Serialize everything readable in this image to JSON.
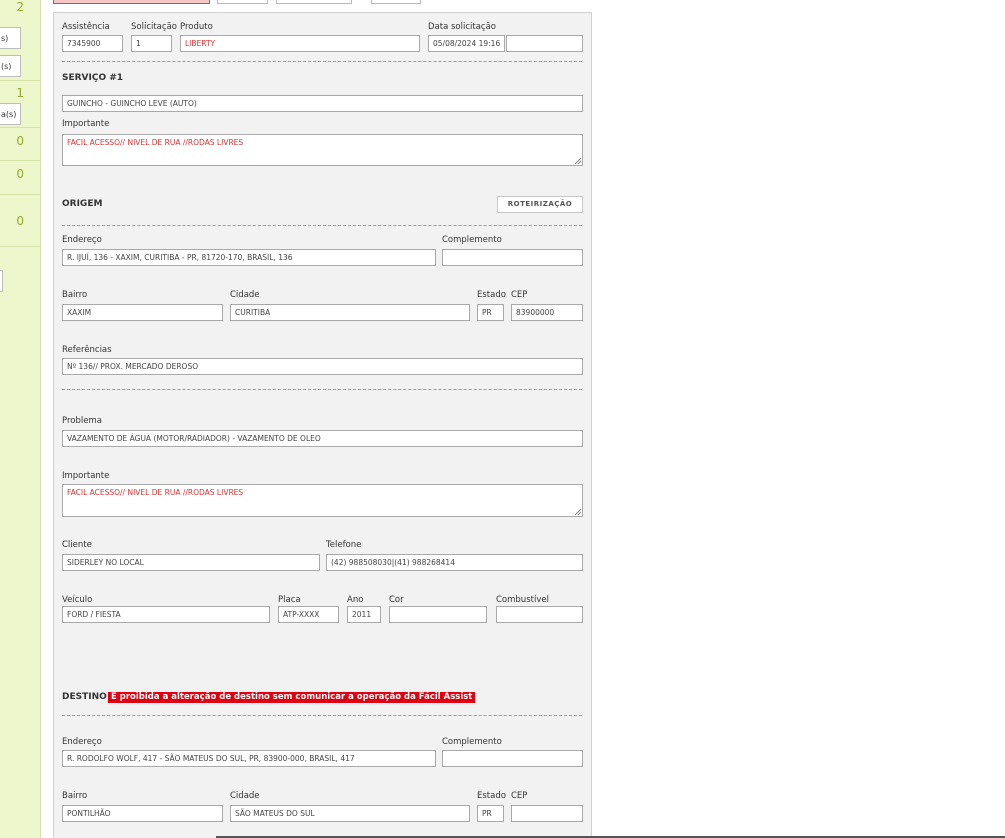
{
  "sidebar": {
    "counts": [
      "2",
      "1",
      "0",
      "0",
      "0"
    ],
    "cut_labels": [
      "s)",
      "(s)",
      "a(s)"
    ]
  },
  "header": {
    "assistencia_label": "Assistência",
    "assistencia_value": "7345900",
    "solicitacao_label": "Solicitação",
    "solicitacao_value": "1",
    "produto_label": "Produto",
    "produto_value": "LIBERTY",
    "data_label": "Data solicitação",
    "data_value": "05/08/2024 19:16",
    "data_extra": ""
  },
  "servico": {
    "title": "SERVIÇO #1",
    "value": "GUINCHO - GUINCHO LEVE (AUTO)",
    "importante_label": "Importante",
    "importante_value": "FACIL ACESSO// NIVEL DE RUA //RODAS LIVRES"
  },
  "origem": {
    "title": "ORIGEM",
    "routing_button": "ROTEIRIZAÇÃO",
    "endereco_label": "Endereço",
    "endereco_value": "R. IJUÍ, 136 - XAXIM, CURITIBA - PR, 81720-170, BRASIL, 136",
    "complemento_label": "Complemento",
    "complemento_value": "",
    "bairro_label": "Bairro",
    "bairro_value": "XAXIM",
    "cidade_label": "Cidade",
    "cidade_value": "CURITIBA",
    "estado_label": "Estado",
    "estado_value": "PR",
    "cep_label": "CEP",
    "cep_value": "83900000",
    "referencias_label": "Referências",
    "referencias_value": "Nº 136// PROX. MERCADO DEROSO"
  },
  "problema": {
    "label": "Problema",
    "value": "VAZAMENTO DE ÁGUA (MOTOR/RADIADOR) - VAZAMENTO DE OLEO",
    "importante_label": "Importante",
    "importante_value": "FACIL ACESSO// NIVEL DE RUA //RODAS LIVRES"
  },
  "cliente": {
    "cliente_label": "Cliente",
    "cliente_value": "SIDERLEY NO LOCAL",
    "telefone_label": "Telefone",
    "telefone_value": "(42) 988508030|(41) 988268414"
  },
  "veiculo": {
    "veiculo_label": "Veículo",
    "veiculo_value": "FORD / FIESTA",
    "placa_label": "Placa",
    "placa_value": "ATP-XXXX",
    "ano_label": "Ano",
    "ano_value": "2011",
    "cor_label": "Cor",
    "cor_value": "",
    "combustivel_label": "Combustível",
    "combustivel_value": ""
  },
  "destino": {
    "title": "DESTINO",
    "warning": "É proibida a alteração de destino sem comunicar a operação da Fácil Assist",
    "endereco_label": "Endereço",
    "endereco_value": "R. RODOLFO WOLF, 417 - SÃO MATEUS DO SUL, PR, 83900-000, BRASIL, 417",
    "complemento_label": "Complemento",
    "complemento_value": "",
    "bairro_label": "Bairro",
    "bairro_value": "PONTILHÃO",
    "cidade_label": "Cidade",
    "cidade_value": "SÃO MATEUS DO SUL",
    "estado_label": "Estado",
    "estado_value": "PR",
    "cep_label": "CEP",
    "cep_value": ""
  },
  "colors": {
    "sidebar_bg": "#eef6cc",
    "important_text": "#dd3333",
    "warning_bg": "#e0000f"
  }
}
